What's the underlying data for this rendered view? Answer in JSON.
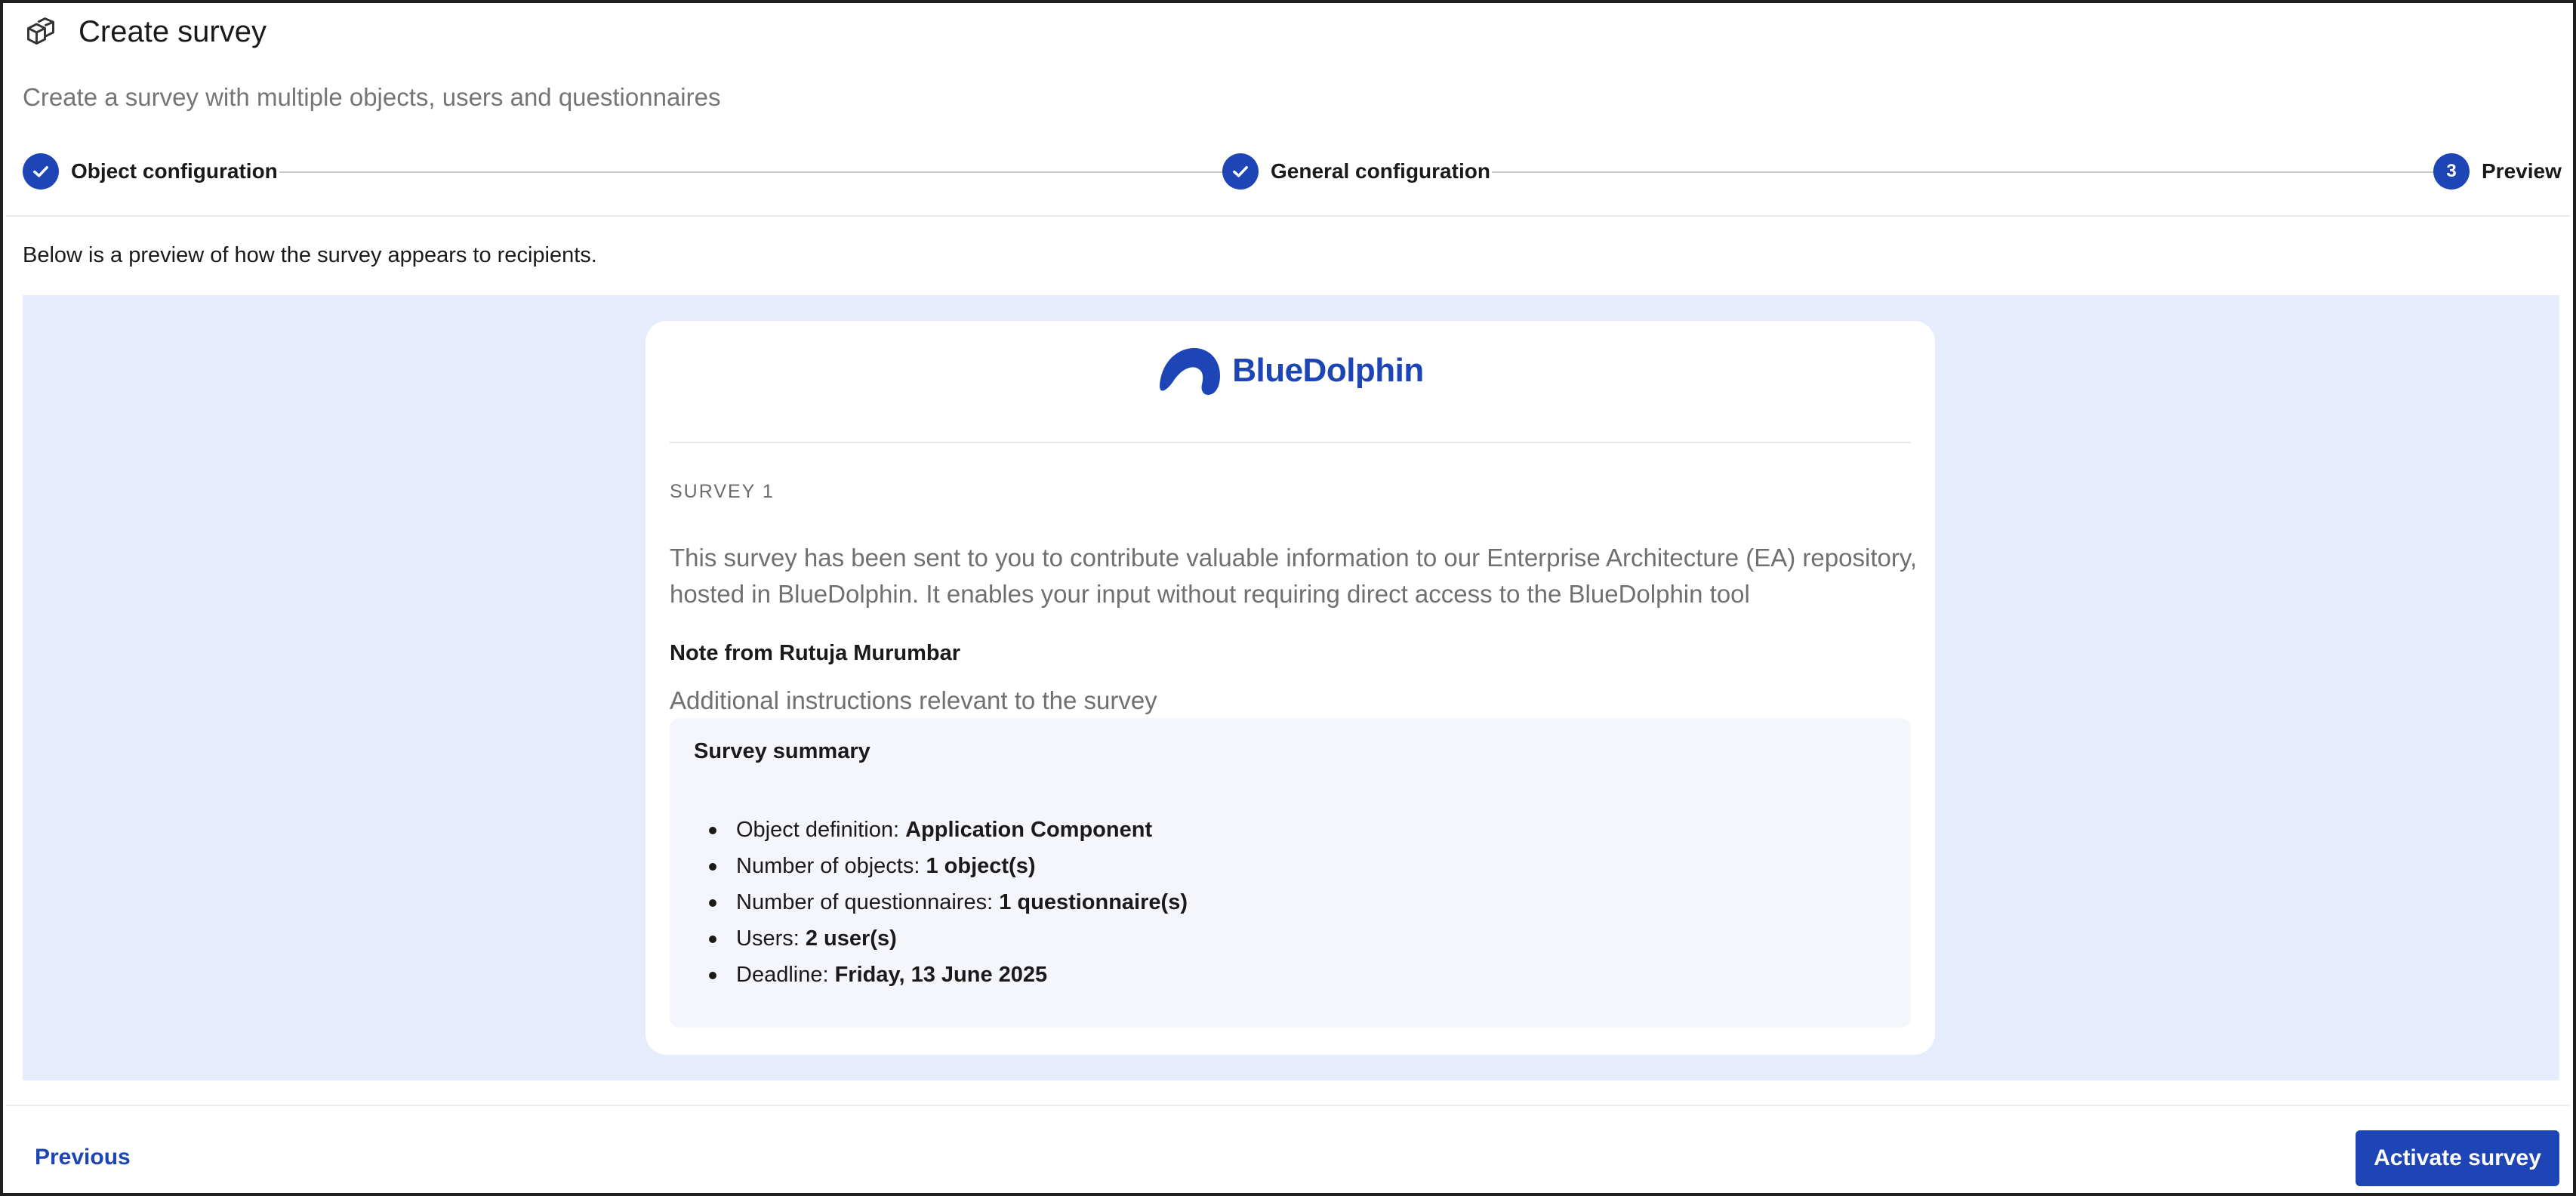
{
  "header": {
    "title": "Create survey",
    "subtitle": "Create a survey with multiple objects, users and questionnaires",
    "icon": "cubes-icon"
  },
  "stepper": {
    "steps": [
      {
        "label": "Object configuration",
        "state": "completed",
        "marker": "check-icon"
      },
      {
        "label": "General configuration",
        "state": "completed",
        "marker": "check-icon"
      },
      {
        "label": "Preview",
        "state": "current",
        "number": "3"
      }
    ]
  },
  "intro": "Below is a preview of how the survey appears to recipients.",
  "preview": {
    "logo_text": "BlueDolphin",
    "survey_name": "SURVEY 1",
    "description": "This survey has been sent to you to contribute valuable information to our Enterprise Architecture (EA) repository, hosted in BlueDolphin. It enables your input without requiring direct access to the BlueDolphin tool",
    "note_heading": "Note from Rutuja Murumbar",
    "note_text": "Additional instructions relevant to the survey",
    "summary": {
      "title": "Survey summary",
      "items": [
        {
          "label": "Object definition:",
          "value": "Application Component"
        },
        {
          "label": "Number of objects:",
          "value": "1 object(s)"
        },
        {
          "label": "Number of questionnaires:",
          "value": "1 questionnaire(s)"
        },
        {
          "label": "Users:",
          "value": "2 user(s)"
        },
        {
          "label": "Deadline:",
          "value": "Friday, 13 June 2025"
        }
      ]
    }
  },
  "footer": {
    "previous_label": "Previous",
    "activate_label": "Activate survey"
  },
  "colors": {
    "accent": "#1d45b5",
    "preview_background": "#e6ecfb",
    "summary_background": "#f4f6fb"
  }
}
